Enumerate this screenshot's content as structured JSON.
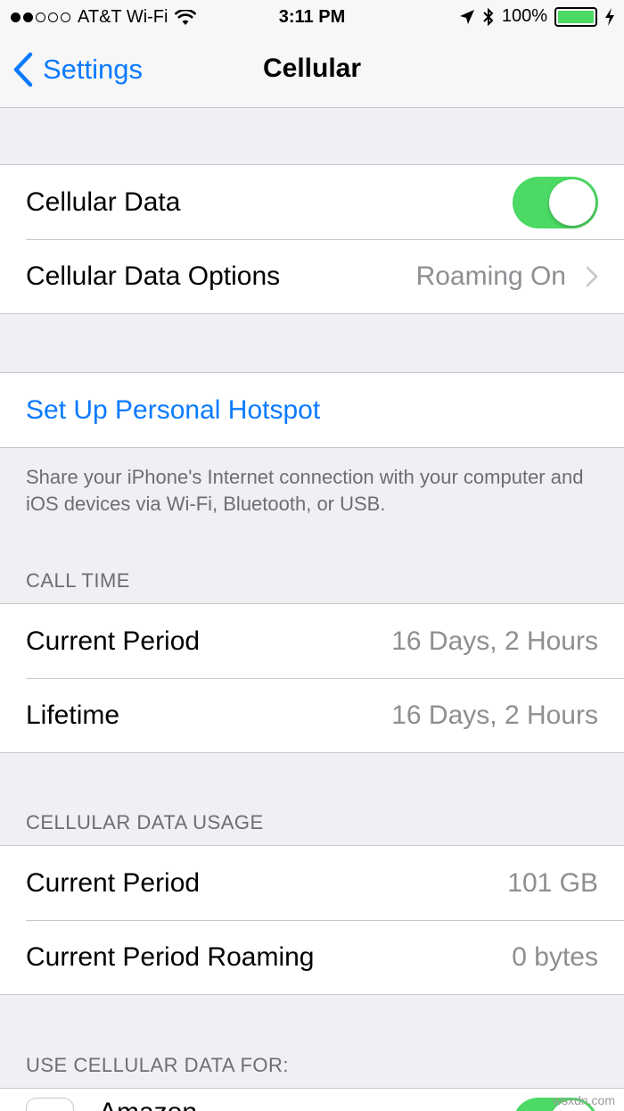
{
  "status_bar": {
    "carrier": "AT&T Wi-Fi",
    "time": "3:11 PM",
    "battery": "100%",
    "signal_dots_filled": 2,
    "signal_dots_total": 5
  },
  "nav": {
    "back_label": "Settings",
    "title": "Cellular"
  },
  "cellular_data": {
    "label": "Cellular Data",
    "enabled": true
  },
  "cellular_data_options": {
    "label": "Cellular Data Options",
    "value": "Roaming On"
  },
  "hotspot": {
    "label": "Set Up Personal Hotspot",
    "footer": "Share your iPhone's Internet connection with your computer and iOS devices via Wi-Fi, Bluetooth, or USB."
  },
  "call_time": {
    "header": "CALL TIME",
    "rows": [
      {
        "label": "Current Period",
        "value": "16 Days, 2 Hours"
      },
      {
        "label": "Lifetime",
        "value": "16 Days, 2 Hours"
      }
    ]
  },
  "data_usage": {
    "header": "CELLULAR DATA USAGE",
    "rows": [
      {
        "label": "Current Period",
        "value": "101 GB"
      },
      {
        "label": "Current Period Roaming",
        "value": "0 bytes"
      }
    ]
  },
  "use_for": {
    "header": "USE CELLULAR DATA FOR:",
    "first_app": "Amazon"
  },
  "watermark": "wsxdn.com",
  "colors": {
    "accent": "#0a7aff",
    "toggle_on": "#4cd964",
    "background": "#efeff4"
  }
}
